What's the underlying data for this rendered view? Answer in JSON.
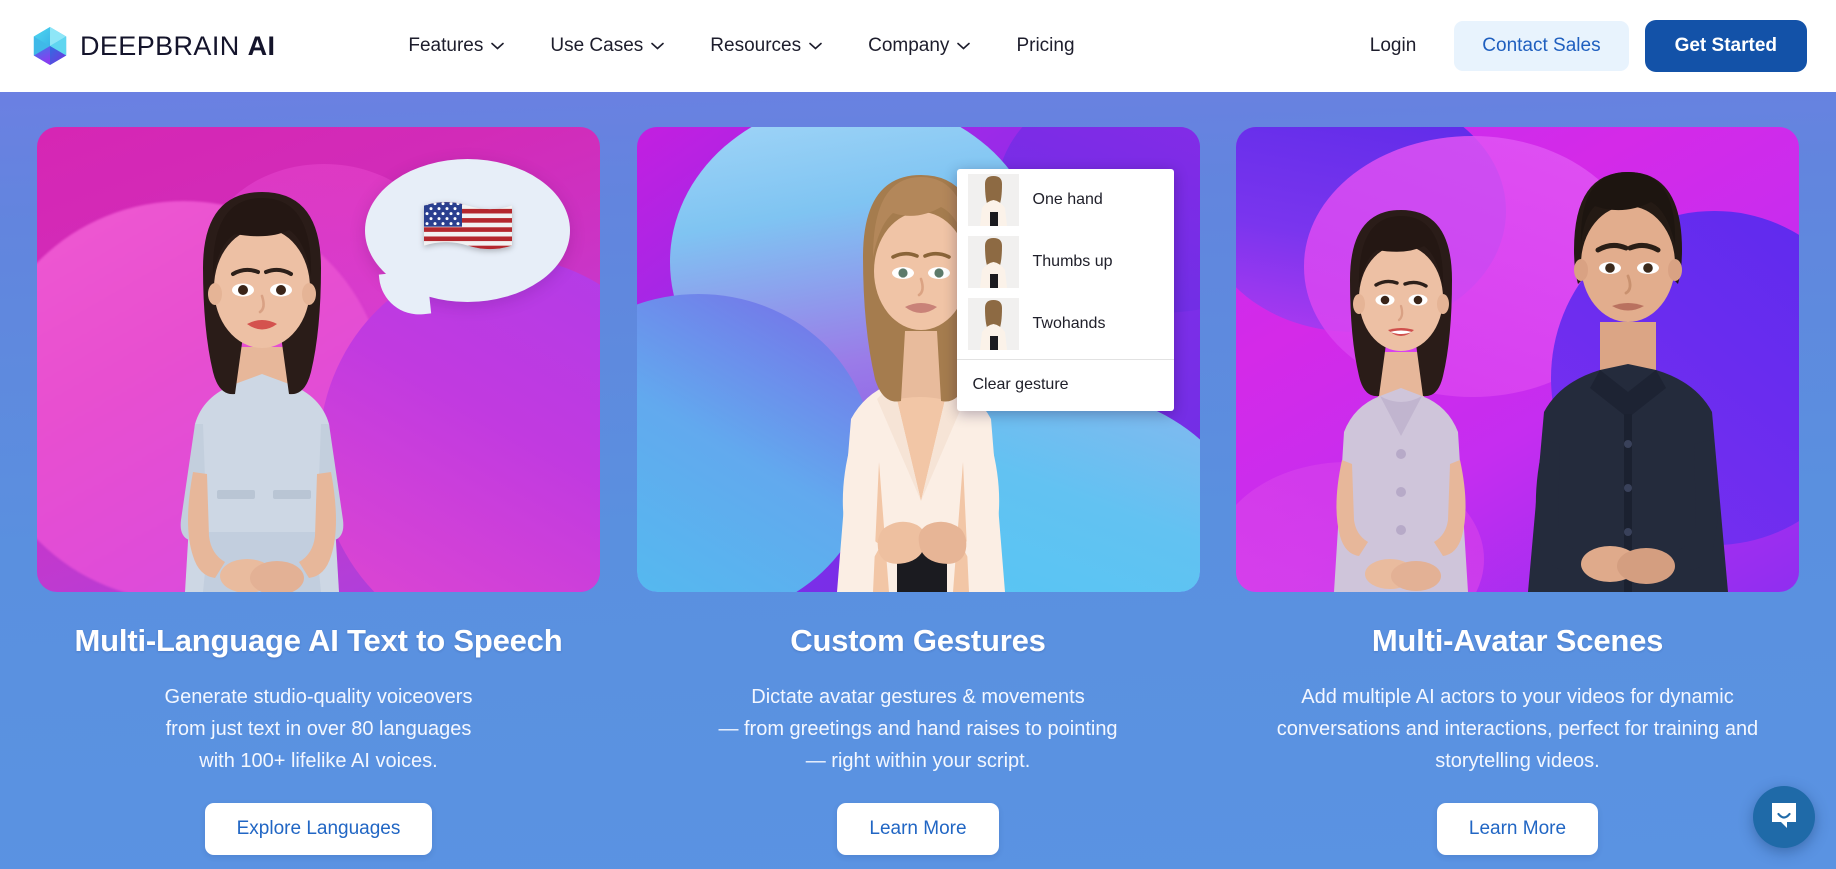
{
  "header": {
    "brand": {
      "name_light": "DEEPBRAIN",
      "name_bold": "AI",
      "logo_icon": "deepbrain-cube-icon"
    },
    "nav": [
      {
        "label": "Features",
        "has_caret": true
      },
      {
        "label": "Use Cases",
        "has_caret": true
      },
      {
        "label": "Resources",
        "has_caret": true
      },
      {
        "label": "Company",
        "has_caret": true
      },
      {
        "label": "Pricing",
        "has_caret": false
      }
    ],
    "login_label": "Login",
    "contact_sales_label": "Contact Sales",
    "get_started_label": "Get Started",
    "colors": {
      "contact_bg": "#e8f3fd",
      "contact_text": "#1f5fbf",
      "get_started_bg": "#1352a8",
      "get_started_text": "#ffffff",
      "nav_text": "#1d1d2c",
      "header_bg": "#ffffff"
    }
  },
  "hero": {
    "background_gradient_from": "#6b80e2",
    "background_gradient_to": "#5a93e2",
    "cards": [
      {
        "title": "Multi-Language AI Text to Speech",
        "desc_lines": [
          "Generate studio-quality voiceovers",
          "from just text in over 80 languages",
          "with 100+ lifelike AI voices."
        ],
        "cta_label": "Explore Languages",
        "media_alt": "ai-avatar-woman-with-us-flag-speech-bubble",
        "bubble_emoji": "us-flag-emoji"
      },
      {
        "title": "Custom Gestures",
        "desc_lines": [
          "Dictate avatar gestures & movements",
          "— from greetings and hand raises to pointing",
          "— right within your script."
        ],
        "cta_label": "Learn More",
        "media_alt": "ai-avatar-woman-with-gesture-menu",
        "gesture_menu": {
          "options": [
            "One hand",
            "Thumbs up",
            "Twohands"
          ],
          "clear_label": "Clear gesture"
        }
      },
      {
        "title": "Multi-Avatar Scenes",
        "desc_lines": [
          "Add multiple AI actors to your videos for dynamic",
          "conversations and interactions, perfect for training and",
          "storytelling videos."
        ],
        "cta_label": "Learn More",
        "media_alt": "two-ai-avatars-woman-and-man"
      }
    ]
  },
  "chat_widget": {
    "icon": "chat-bubble-icon",
    "color": "#1f6aa8"
  }
}
